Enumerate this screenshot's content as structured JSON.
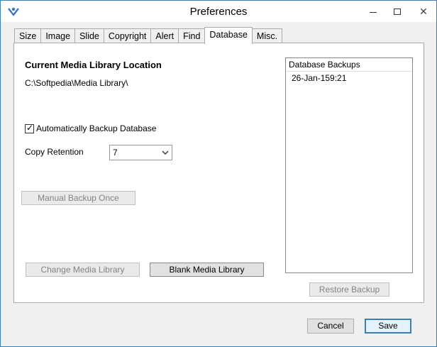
{
  "window": {
    "title": "Preferences",
    "minimize_glyph": "—",
    "close_glyph": "✕",
    "icon": "app-logo-icon",
    "accent_color": "#3c7fb1"
  },
  "tabs": [
    {
      "label": "Size",
      "active": false
    },
    {
      "label": "Image",
      "active": false
    },
    {
      "label": "Slide",
      "active": false
    },
    {
      "label": "Copyright",
      "active": false
    },
    {
      "label": "Alert",
      "active": false
    },
    {
      "label": "Find",
      "active": false
    },
    {
      "label": "Database",
      "active": true
    },
    {
      "label": "Misc.",
      "active": false
    }
  ],
  "database": {
    "heading": "Current Media Library Location",
    "path": "C:\\Softpedia\\Media Library\\",
    "auto_backup": {
      "label": "Automatically Backup Database",
      "checked": true,
      "check_glyph": "✓"
    },
    "copy_retention": {
      "label": "Copy Retention",
      "value": "7"
    },
    "manual_backup_label": "Manual Backup Once",
    "change_library_label": "Change Media Library",
    "blank_library_label": "Blank Media Library",
    "backups": {
      "header": "Database Backups",
      "items": [
        "26-Jan-159:21"
      ]
    },
    "restore_label": "Restore Backup"
  },
  "footer": {
    "cancel_label": "Cancel",
    "save_label": "Save"
  }
}
